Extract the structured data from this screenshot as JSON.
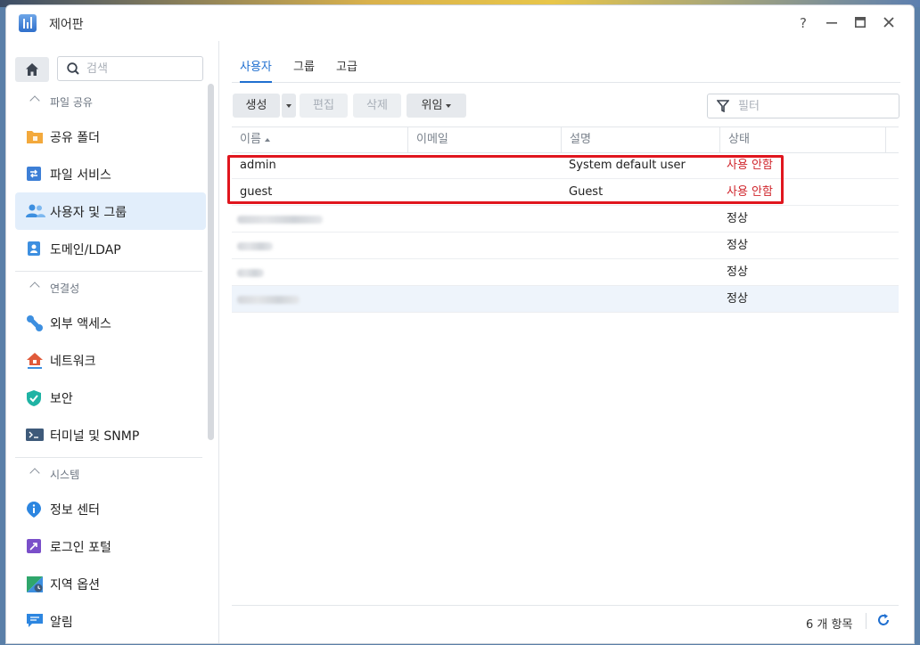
{
  "window": {
    "title": "제어판",
    "controls": {
      "help": "?",
      "minimize": "—",
      "maximize": "▣",
      "close": "✕"
    }
  },
  "sidebar": {
    "search_placeholder": "검색",
    "groups": [
      {
        "label": "파일 공유",
        "items": [
          {
            "label": "공유 폴더",
            "icon": "folder-icon",
            "color": "#f3a93c"
          },
          {
            "label": "파일 서비스",
            "icon": "file-services-icon",
            "color": "#3d7fd6"
          },
          {
            "label": "사용자 및 그룹",
            "icon": "users-icon",
            "color": "#3d8fe0",
            "active": true
          },
          {
            "label": "도메인/LDAP",
            "icon": "id-card-icon",
            "color": "#3d8fe0"
          }
        ]
      },
      {
        "label": "연결성",
        "items": [
          {
            "label": "외부 액세스",
            "icon": "external-access-icon",
            "color": "#3d8fe0"
          },
          {
            "label": "네트워크",
            "icon": "network-icon",
            "color": "#e05a3a"
          },
          {
            "label": "보안",
            "icon": "shield-icon",
            "color": "#1fb3a4"
          },
          {
            "label": "터미널 및 SNMP",
            "icon": "terminal-icon",
            "color": "#3e5a7a"
          }
        ]
      },
      {
        "label": "시스템",
        "items": [
          {
            "label": "정보 센터",
            "icon": "info-icon",
            "color": "#2d86e0"
          },
          {
            "label": "로그인 포털",
            "icon": "login-portal-icon",
            "color": "#7a4fc9"
          },
          {
            "label": "지역 옵션",
            "icon": "region-icon",
            "color": "#2fa66b"
          },
          {
            "label": "알림",
            "icon": "notification-icon",
            "color": "#2d86e0"
          }
        ]
      }
    ]
  },
  "tabs": [
    {
      "label": "사용자",
      "active": true
    },
    {
      "label": "그룹"
    },
    {
      "label": "고급"
    }
  ],
  "toolbar": {
    "create": "생성",
    "edit": "편집",
    "delete": "삭제",
    "delegate": "위임",
    "filter_placeholder": "필터"
  },
  "table": {
    "columns": [
      "이름",
      "이메일",
      "설명",
      "상태"
    ],
    "rows": [
      {
        "name": "admin",
        "email": "",
        "description": "System default user",
        "status": "사용 안함",
        "status_color": "#d0262d"
      },
      {
        "name": "guest",
        "email": "",
        "description": "Guest",
        "status": "사용 안함",
        "status_color": "#d0262d"
      },
      {
        "name": "",
        "email": "",
        "description": "",
        "status": "정상",
        "blurred": true
      },
      {
        "name": "",
        "email": "",
        "description": "",
        "status": "정상",
        "blurred": true
      },
      {
        "name": "",
        "email": "",
        "description": "",
        "status": "정상",
        "blurred": true
      },
      {
        "name": "",
        "email": "",
        "description": "",
        "status": "정상",
        "blurred": true,
        "selected": true
      }
    ]
  },
  "footer": {
    "count": "6 개 항목"
  },
  "colors": {
    "accent": "#1f6fd0",
    "highlight": "#e0161e",
    "disabled": "#d0262d"
  }
}
